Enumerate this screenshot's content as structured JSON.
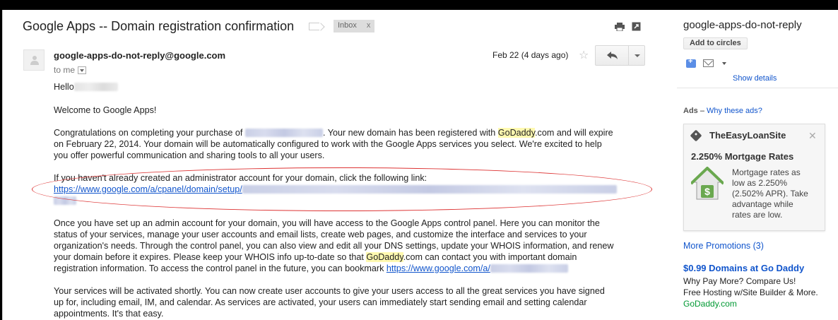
{
  "email": {
    "subject": "Google Apps -- Domain registration confirmation",
    "label": "Inbox",
    "label_close": "x",
    "sender": "google-apps-do-not-reply@google.com",
    "recipient": "to me",
    "date": "Feb 22 (4 days ago)",
    "star": "☆",
    "greeting": "Hello",
    "welcome": "Welcome to Google Apps!",
    "p1_a": "Congratulations on completing your purchase of",
    "p1_b": ". Your new domain has been registered with",
    "p1_godaddy": "GoDaddy",
    "p1_c": ".com and will expire",
    "p1_line2": "on February 22, 2014. Your domain will be automatically configured to work with the Google Apps services you select. We're excited to help",
    "p1_line3": "you offer powerful communication and sharing tools to all your users.",
    "p2_line1": "If you haven't already created an administrator account for your domain, click the following link:",
    "p2_link": "https://www.google.com/a/cpanel/domain/setup/",
    "p3_line1": "Once you have set up an admin account for your domain, you will have access to the Google Apps control panel. Here you can monitor the",
    "p3_line2": "status of your services, manage your user accounts and email lists, create web pages, and customize the interface and services to your",
    "p3_line3": "organization's needs. Through the control panel, you can also view and edit all your DNS settings, update your WHOIS information, and renew",
    "p3_line4_a": "your domain before it expires. Please keep your WHOIS info up-to-date so that",
    "p3_line4_godaddy": "GoDaddy",
    "p3_line4_b": ".com can contact you with important domain",
    "p3_line5_a": "registration information. To access the control panel in the future, you can bookmark",
    "p3_line5_link": "https://www.google.com/a/",
    "p4_line1": "Your services will be activated shortly. You can now create user accounts to give your users access to all the great services you have signed",
    "p4_line2": "up for, including email, IM, and calendar. As services are activated, your users can immediately start sending email and setting calendar",
    "p4_line3": "appointments. It's that easy."
  },
  "right_panel": {
    "name": "google-apps-do-not-reply",
    "add_to_circles": "Add to circles",
    "show_details": "Show details",
    "ads_label": "Ads",
    "ads_dash": " – ",
    "why_ads": "Why these ads?",
    "ad1": {
      "site": "TheEasyLoanSite",
      "close": "✕",
      "title": "2.250% Mortgage Rates",
      "desc": [
        "Mortgage rates as",
        "low as 2.250%",
        "(2.502% APR). Take",
        "advantage while",
        "rates are low."
      ]
    },
    "more_promotions": "More Promotions (3)",
    "ad2": {
      "title": "$0.99 Domains at Go Daddy",
      "line1": "Why Pay More? Compare Us!",
      "line2": "Free Hosting w/Site Builder & More.",
      "url": "GoDaddy.com"
    }
  },
  "colors": {
    "link": "#1155cc",
    "highlight": "#fff9b0",
    "annotation_ellipse": "#dd3333",
    "ad_url": "#009933"
  },
  "icons": [
    "print-icon",
    "popout-icon",
    "star-icon",
    "reply-icon",
    "plus-icon",
    "mail-icon",
    "tag-icon",
    "house-icon"
  ]
}
